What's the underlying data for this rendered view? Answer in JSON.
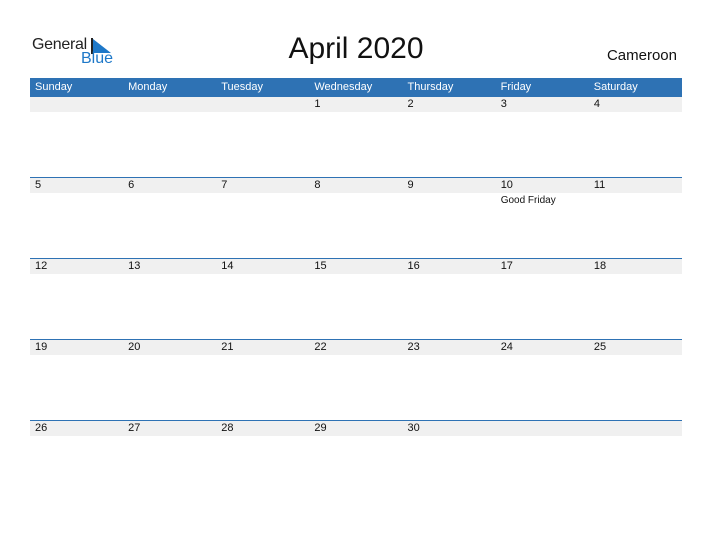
{
  "logo": {
    "general": "General",
    "blue": "Blue",
    "icon": "triangle-flag-icon"
  },
  "title": "April 2020",
  "country": "Cameroon",
  "weekdays": [
    "Sunday",
    "Monday",
    "Tuesday",
    "Wednesday",
    "Thursday",
    "Friday",
    "Saturday"
  ],
  "weeks": [
    {
      "days": [
        "",
        "",
        "",
        "1",
        "2",
        "3",
        "4"
      ],
      "events": [
        "",
        "",
        "",
        "",
        "",
        "",
        ""
      ]
    },
    {
      "days": [
        "5",
        "6",
        "7",
        "8",
        "9",
        "10",
        "11"
      ],
      "events": [
        "",
        "",
        "",
        "",
        "",
        "Good Friday",
        ""
      ]
    },
    {
      "days": [
        "12",
        "13",
        "14",
        "15",
        "16",
        "17",
        "18"
      ],
      "events": [
        "",
        "",
        "",
        "",
        "",
        "",
        ""
      ]
    },
    {
      "days": [
        "19",
        "20",
        "21",
        "22",
        "23",
        "24",
        "25"
      ],
      "events": [
        "",
        "",
        "",
        "",
        "",
        "",
        ""
      ]
    },
    {
      "days": [
        "26",
        "27",
        "28",
        "29",
        "30",
        "",
        ""
      ],
      "events": [
        "",
        "",
        "",
        "",
        "",
        "",
        ""
      ]
    }
  ],
  "colors": {
    "header": "#2e72b4",
    "accent": "#1e78c8",
    "daystrip": "#f0f0f0"
  }
}
